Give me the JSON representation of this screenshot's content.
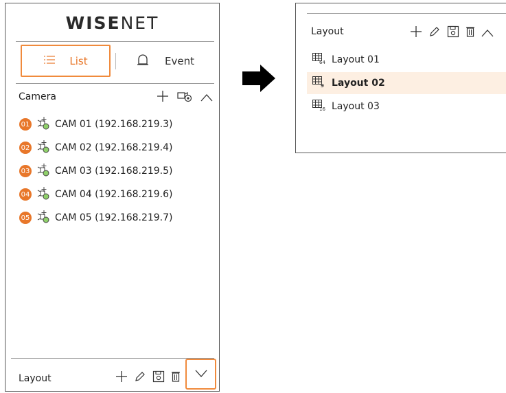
{
  "left_panel": {
    "logo_bold": "WISE",
    "logo_light": "NET",
    "tabs": {
      "list": "List",
      "event": "Event"
    },
    "camera_section": {
      "title": "Camera"
    },
    "cameras": [
      {
        "num": "01",
        "label": "CAM 01 (192.168.219.3)"
      },
      {
        "num": "02",
        "label": "CAM 02 (192.168.219.4)"
      },
      {
        "num": "03",
        "label": "CAM 03 (192.168.219.5)"
      },
      {
        "num": "04",
        "label": "CAM 04 (192.168.219.6)"
      },
      {
        "num": "05",
        "label": "CAM 05 (192.168.219.7)"
      }
    ],
    "layout_section": {
      "title": "Layout"
    }
  },
  "right_panel": {
    "layout_section": {
      "title": "Layout"
    },
    "layouts": [
      {
        "grid": "64",
        "label": "Layout 01",
        "selected": false
      },
      {
        "grid": "9",
        "label": "Layout 02",
        "selected": true
      },
      {
        "grid": "16",
        "label": "Layout 03",
        "selected": false
      }
    ]
  },
  "colors": {
    "accent": "#e8772a",
    "highlight_border": "#f08a3c",
    "selected_row": "#fdefe2"
  },
  "icons": [
    "list-icon",
    "bell-icon",
    "plus-icon",
    "add-camera-icon",
    "chevron-up-icon",
    "pencil-icon",
    "save-icon",
    "trash-icon",
    "chevron-down-icon",
    "camera-move-icon",
    "layout-grid-icon",
    "right-arrow-icon"
  ]
}
